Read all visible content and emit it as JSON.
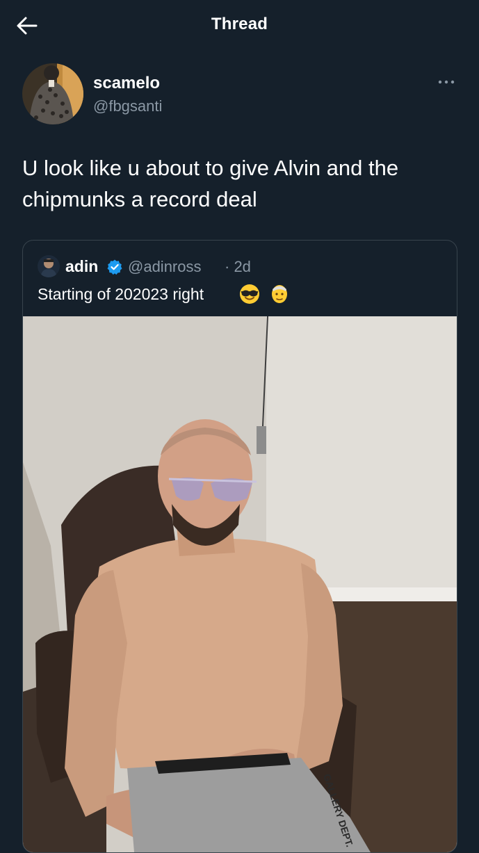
{
  "header": {
    "title": "Thread",
    "back_icon": "arrow-left-icon"
  },
  "tweet": {
    "display_name": "scamelo",
    "handle": "@fbgsanti",
    "text": "U look like u about to give Alvin and the chipmunks a record deal",
    "more_icon": "ellipsis-icon"
  },
  "quote": {
    "display_name": "adin",
    "verified_icon": "verified-badge-icon",
    "handle": "@adinross",
    "time": "· 2d",
    "text": "Starting of 202023 right",
    "emojis": [
      "smiling-face-with-sunglasses",
      "older-person"
    ],
    "photo_text": "GALLERY DEPT."
  },
  "colors": {
    "background": "#15202b",
    "secondary_text": "#8b98a5",
    "border": "#38444d",
    "verified": "#1d9bf0"
  }
}
